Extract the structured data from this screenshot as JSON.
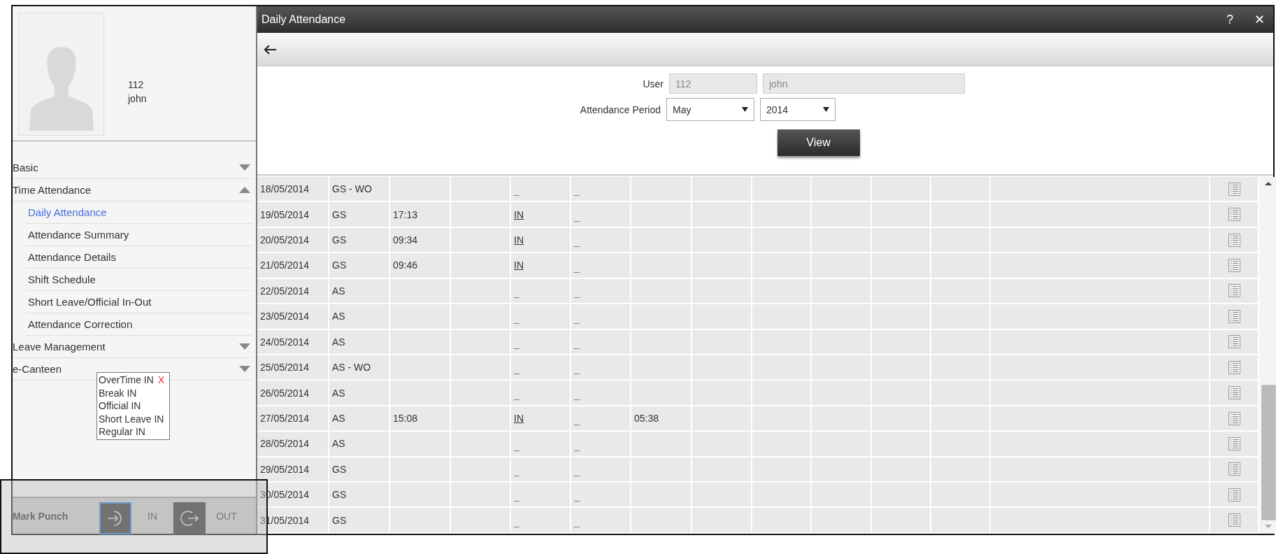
{
  "user_card": {
    "id": "112",
    "name": "john"
  },
  "menu": [
    {
      "label": "Basic",
      "expanded": false
    },
    {
      "label": "Time Attendance",
      "expanded": true,
      "children": [
        {
          "label": "Daily Attendance",
          "selected": true
        },
        {
          "label": "Attendance Summary",
          "selected": false
        },
        {
          "label": "Attendance Details",
          "selected": false
        },
        {
          "label": "Shift Schedule",
          "selected": false
        },
        {
          "label": "Short Leave/Official In-Out",
          "selected": false
        },
        {
          "label": "Attendance Correction",
          "selected": false
        }
      ]
    },
    {
      "label": "Leave Management",
      "expanded": false
    },
    {
      "label": "e-Canteen",
      "expanded": false
    }
  ],
  "punch_popup": {
    "close": "X",
    "items": [
      "OverTime IN",
      "Break IN",
      "Official IN",
      "Short Leave IN",
      "Regular IN"
    ]
  },
  "mark_punch": {
    "label": "Mark Punch",
    "buttons": [
      {
        "kind": "in",
        "label": "IN",
        "selected": true
      },
      {
        "kind": "out",
        "label": "OUT",
        "selected": false
      }
    ]
  },
  "window": {
    "title": "Daily Attendance",
    "help": "?",
    "close": "✕"
  },
  "form": {
    "user_label": "User",
    "user_id": "112",
    "user_name": "john",
    "period_label": "Attendance Period",
    "month": "May",
    "year": "2014",
    "view_button": "View"
  },
  "table": {
    "rows": [
      {
        "date": "18/05/2014",
        "shift": "GS - WO",
        "punch": "_",
        "underlined": false,
        "column_6": "_"
      },
      {
        "date": "19/05/2014",
        "shift": "GS",
        "time": "17:13",
        "punch": "IN",
        "underlined": true,
        "column_6": "_"
      },
      {
        "date": "20/05/2014",
        "shift": "GS",
        "time": "09:34",
        "punch": "IN",
        "underlined": true,
        "column_6": "_"
      },
      {
        "date": "21/05/2014",
        "shift": "GS",
        "time": "09:46",
        "punch": "IN",
        "underlined": true,
        "column_6": "_"
      },
      {
        "date": "22/05/2014",
        "shift": "AS",
        "punch": "_",
        "underlined": false,
        "column_6": "_"
      },
      {
        "date": "23/05/2014",
        "shift": "AS",
        "punch": "_",
        "underlined": false,
        "column_6": "_"
      },
      {
        "date": "24/05/2014",
        "shift": "AS",
        "punch": "_",
        "underlined": false,
        "column_6": "_"
      },
      {
        "date": "25/05/2014",
        "shift": "AS - WO",
        "punch": "_",
        "underlined": false,
        "column_6": "_"
      },
      {
        "date": "26/05/2014",
        "shift": "AS",
        "punch": "_",
        "underlined": false,
        "column_6": "_"
      },
      {
        "date": "27/05/2014",
        "shift": "AS",
        "time": "15:08",
        "punch": "IN",
        "underlined": true,
        "column_6": "_",
        "column_7": "05:38"
      },
      {
        "date": "28/05/2014",
        "shift": "AS",
        "punch": "_",
        "underlined": false,
        "column_6": "_"
      },
      {
        "date": "29/05/2014",
        "shift": "GS",
        "punch": "_",
        "underlined": false,
        "column_6": "_"
      },
      {
        "date": "30/05/2014",
        "shift": "GS",
        "punch": "_",
        "underlined": false,
        "column_6": "_"
      },
      {
        "date": "31/05/2014",
        "shift": "GS",
        "punch": "_",
        "underlined": false,
        "column_6": "_"
      }
    ]
  }
}
